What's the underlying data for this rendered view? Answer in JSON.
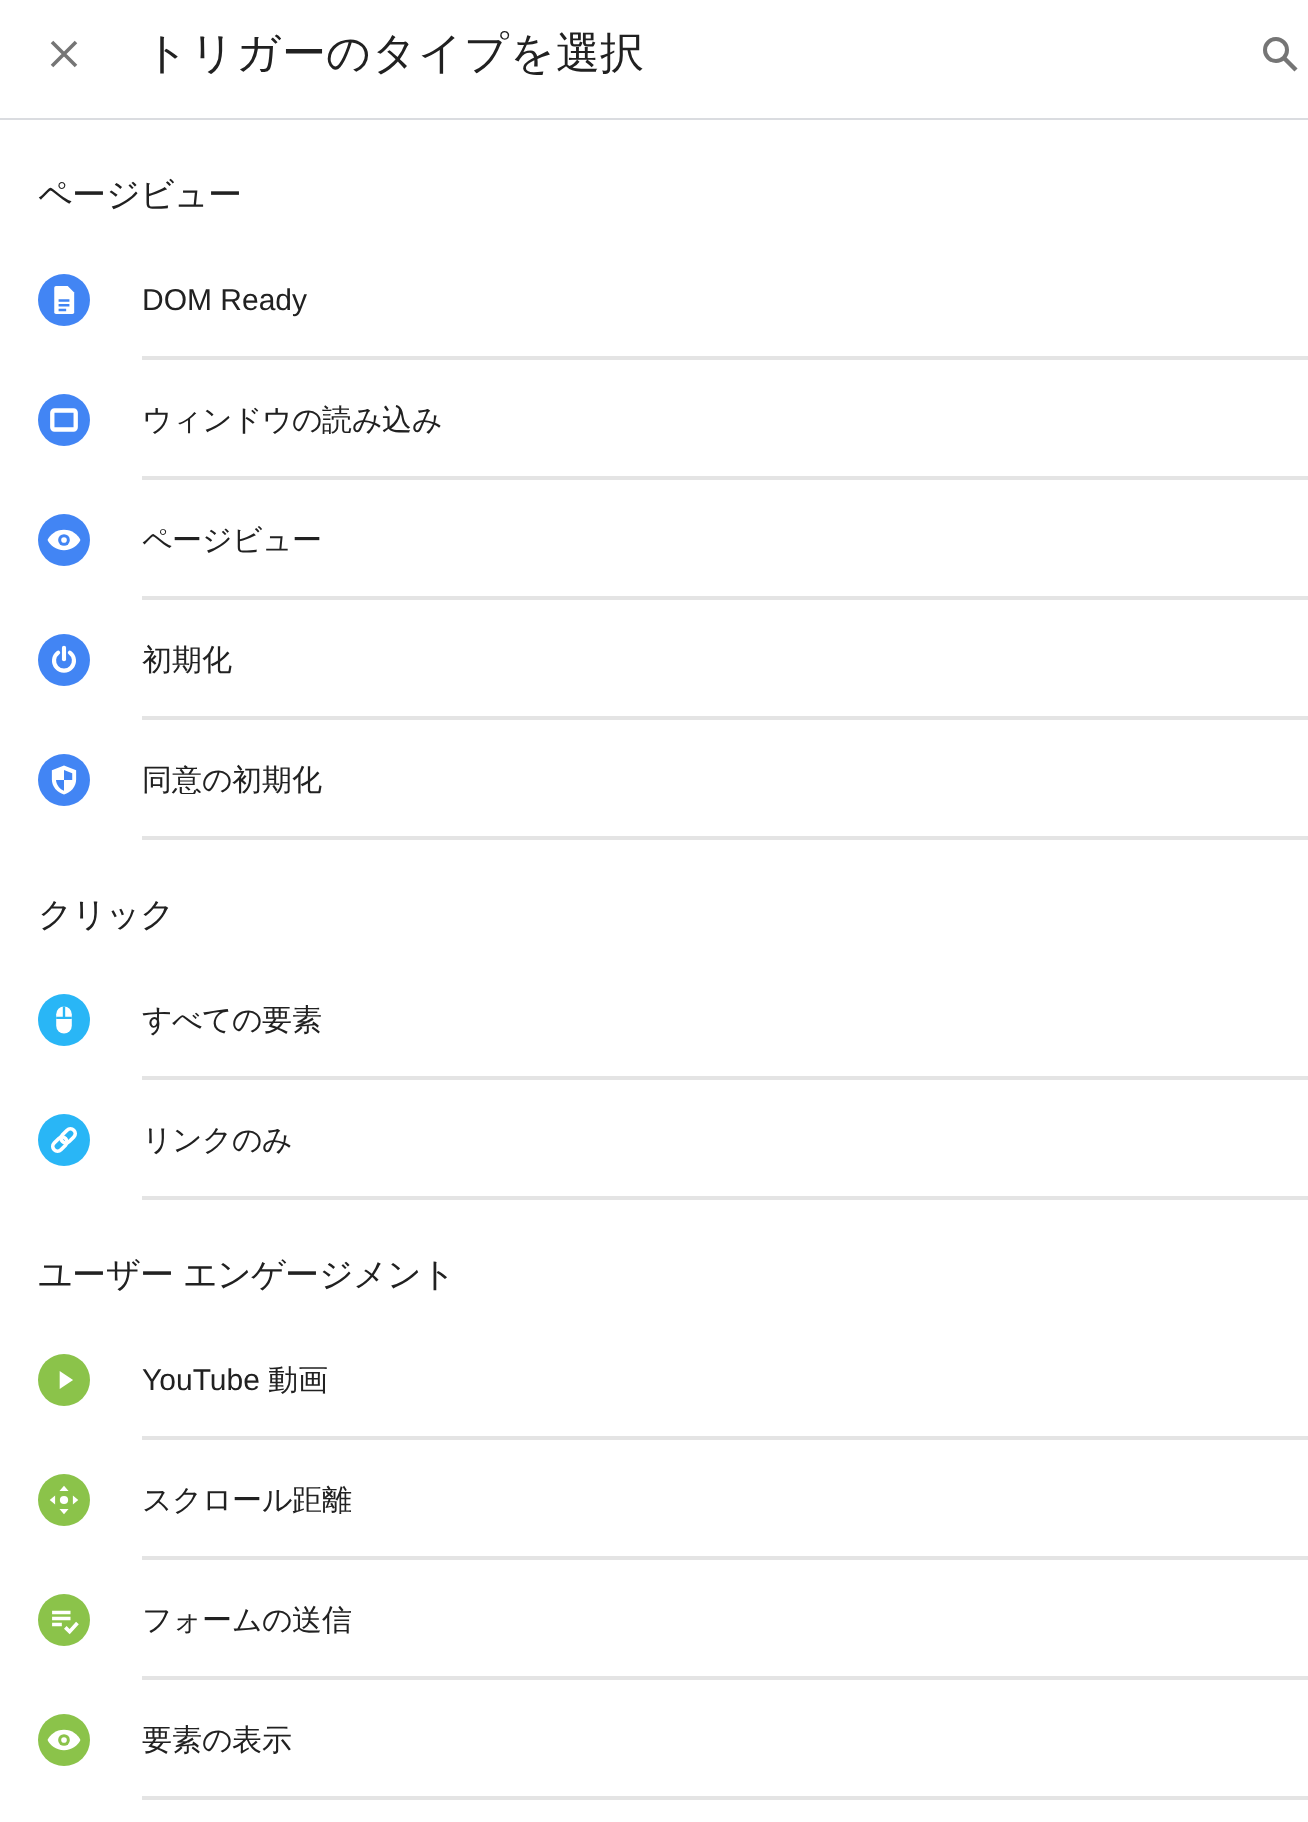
{
  "header": {
    "title": "トリガーのタイプを選択"
  },
  "sections": [
    {
      "heading": "ページビュー",
      "color": "#4285f4",
      "items": [
        {
          "label": "DOM Ready",
          "kind": "document"
        },
        {
          "label": "ウィンドウの読み込み",
          "kind": "window"
        },
        {
          "label": "ページビュー",
          "kind": "eye"
        },
        {
          "label": "初期化",
          "kind": "power"
        },
        {
          "label": "同意の初期化",
          "kind": "shield"
        }
      ]
    },
    {
      "heading": "クリック",
      "color": "#29b6f6",
      "items": [
        {
          "label": "すべての要素",
          "kind": "mouse"
        },
        {
          "label": "リンクのみ",
          "kind": "link"
        }
      ]
    },
    {
      "heading": "ユーザー エンゲージメント",
      "color": "#8bc34a",
      "items": [
        {
          "label": "YouTube 動画",
          "kind": "play"
        },
        {
          "label": "スクロール距離",
          "kind": "move"
        },
        {
          "label": "フォームの送信",
          "kind": "form"
        },
        {
          "label": "要素の表示",
          "kind": "eye"
        }
      ]
    }
  ]
}
